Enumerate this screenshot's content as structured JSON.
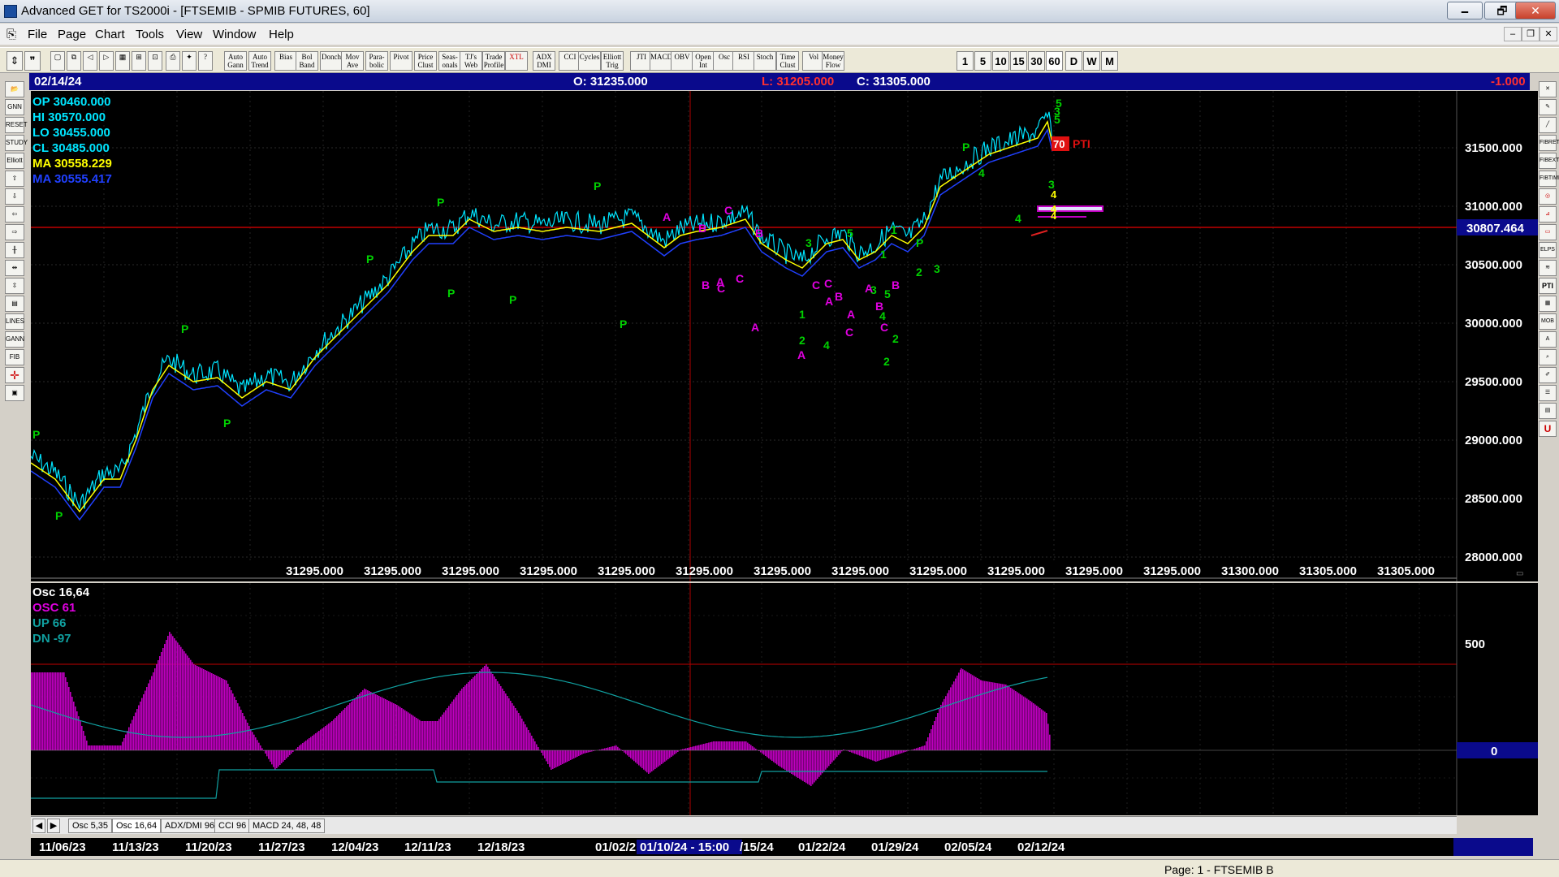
{
  "window": {
    "title": "Advanced GET for TS2000i - [FTSEMIB - SPMIB FUTURES, 60]",
    "min": "🗕",
    "max": "🗗",
    "close": "✕"
  },
  "menu": [
    "File",
    "Page",
    "Chart",
    "Tools",
    "View",
    "Window",
    "Help"
  ],
  "toolbar": {
    "studies": [
      "Auto Gann",
      "Auto Trend",
      "Bias",
      "Bol Band",
      "Donch",
      "Mov Ave",
      "Para- bolic",
      "Pivot",
      "Price Clust",
      "Seas- onals",
      "TJ's Web",
      "Trade Profile",
      "XTL",
      "ADX DMI",
      "CCI",
      "Cycles",
      "Elliott Trig",
      "JTI",
      "MACD",
      "OBV",
      "Open Int",
      "Osc",
      "RSI",
      "Stoch",
      "Time Clust",
      "Vol",
      "Money Flow"
    ],
    "intervals": [
      "1",
      "5",
      "10",
      "15",
      "30",
      "60",
      "D",
      "W",
      "M"
    ]
  },
  "infobar": {
    "date": "02/14/24",
    "open": "O: 31235.000",
    "low": "L: 31205.000",
    "close": "C: 31305.000",
    "change": "-1.000"
  },
  "legend": {
    "op": "OP  30460.000",
    "hi": "HI   30570.000",
    "lo": "LO  30455.000",
    "cl": "CL  30485.000",
    "ma1": "MA  30558.229",
    "ma2": "MA  30555.417"
  },
  "price_axis": [
    "31500.000",
    "31000.000",
    "30500.000",
    "30000.000",
    "29500.000",
    "29000.000",
    "28500.000",
    "28000.000"
  ],
  "current_price_label": "30807.464",
  "pti": {
    "value": "70",
    "label": "PTI"
  },
  "bottom_values": [
    "31295.000",
    "31295.000",
    "31295.000",
    "31295.000",
    "31295.000",
    "31295.000",
    "31295.000",
    "31295.000",
    "31295.000",
    "31295.000",
    "31295.000",
    "31295.000",
    "31300.000",
    "31305.000",
    "31305.000"
  ],
  "osc": {
    "title": "Osc 16,64",
    "osc": "OSC 61",
    "up": "UP    66",
    "dn": "DN   -97",
    "axis_500": "500",
    "axis_0": "0"
  },
  "tabs": [
    "Osc 5,35",
    "Osc 16,64",
    "ADX/DMI 96",
    "CCI 96",
    "MACD 24, 48, 48"
  ],
  "dates": [
    "11/06/23",
    "11/13/23",
    "11/20/23",
    "11/27/23",
    "12/04/23",
    "12/11/23",
    "12/18/23",
    "01/02/2",
    "01/10/24 - 15:00",
    "/15/24",
    "01/22/24",
    "01/29/24",
    "02/05/24",
    "02/12/24"
  ],
  "status": "Page: 1 - FTSEMIB B",
  "colors": {
    "price": "#00e5ff",
    "ma_fast": "#ffff00",
    "ma_slow": "#2040ff",
    "wave_green": "#00d000",
    "wave_magenta": "#e000e0",
    "osc": "#c000c0"
  },
  "wave_labels_green": [
    "P",
    "P",
    "P",
    "P",
    "P",
    "P",
    "P",
    "P",
    "P",
    "P",
    "P",
    "P",
    "1",
    "2",
    "3",
    "4",
    "5",
    "1",
    "2",
    "3",
    "4",
    "5",
    "2",
    "3",
    "4",
    "4",
    "3",
    "5",
    "3",
    "5",
    "2",
    "1"
  ],
  "wave_labels_magenta": [
    "A",
    "B",
    "C",
    "A",
    "C",
    "B",
    "A",
    "B",
    "C",
    "A",
    "C",
    "A",
    "B",
    "C",
    "A",
    "B",
    "A",
    "C",
    "B",
    "C"
  ],
  "fib_marks": [
    "4",
    "4",
    "4"
  ]
}
